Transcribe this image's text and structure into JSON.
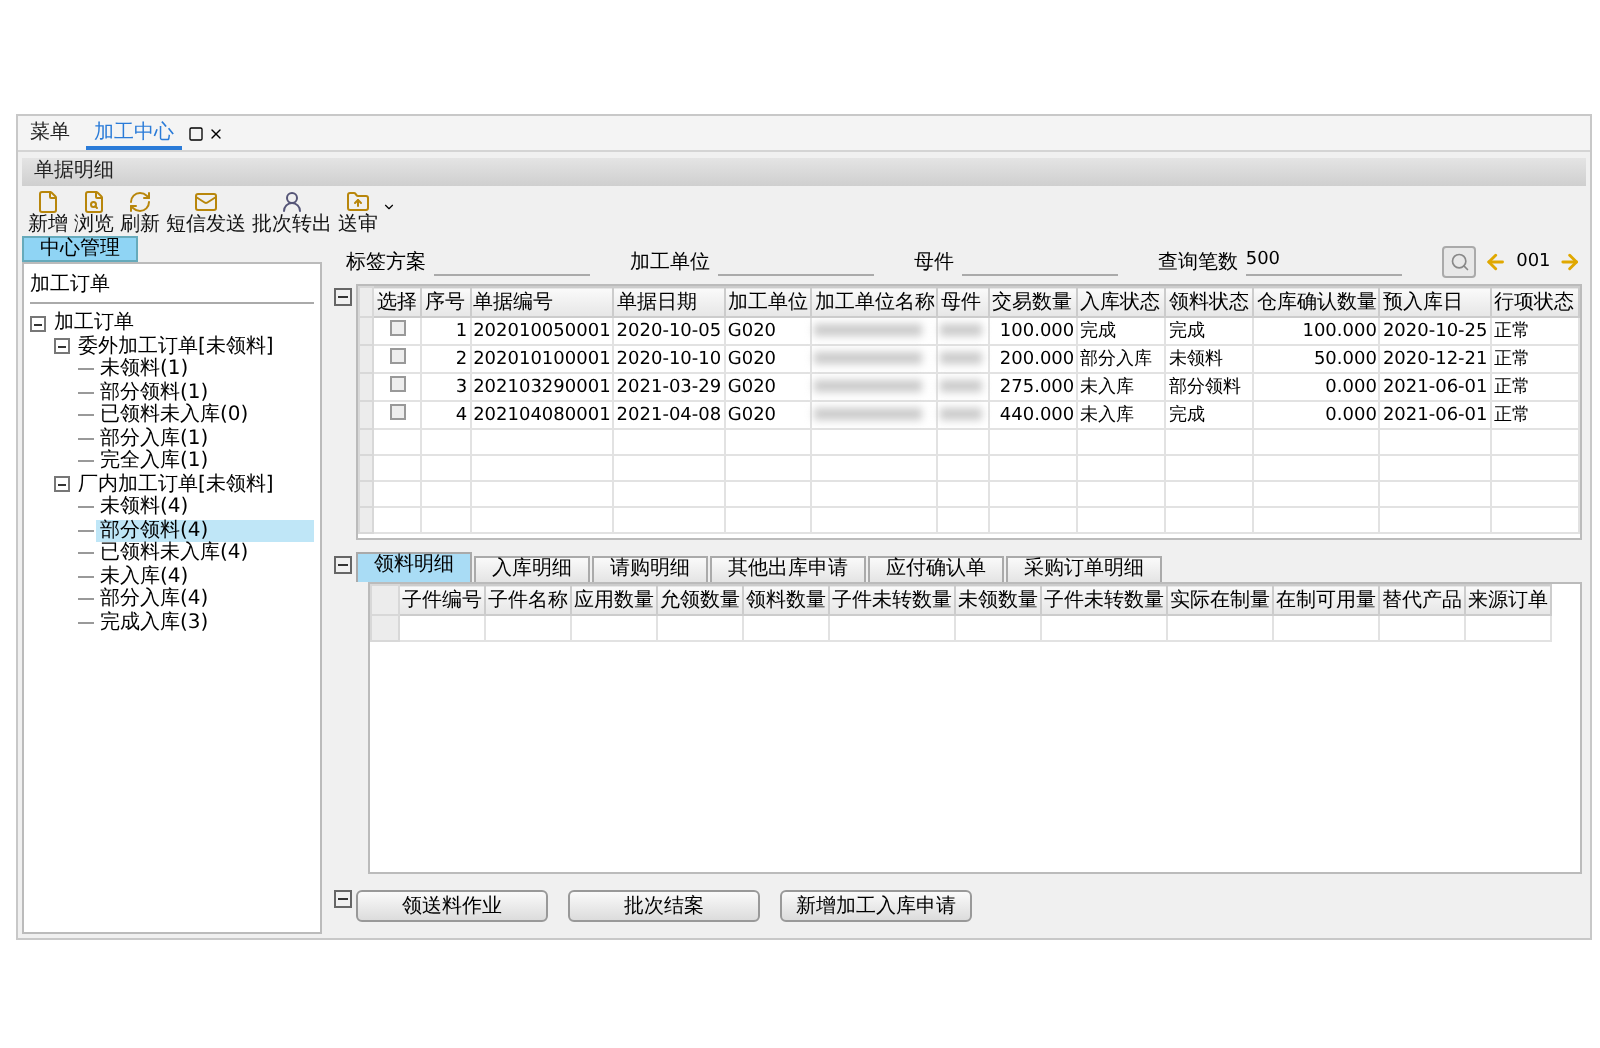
{
  "top_tabs": [
    {
      "label": "菜单",
      "selected": false
    },
    {
      "label": "加工中心",
      "selected": true,
      "closable": true
    }
  ],
  "title": "单据明细",
  "toolbar": [
    {
      "kind": "new",
      "label": "新增"
    },
    {
      "kind": "browse",
      "label": "浏览"
    },
    {
      "kind": "refresh",
      "label": "刷新"
    },
    {
      "kind": "mail",
      "label": "短信发送"
    },
    {
      "kind": "transfer",
      "label": "批次转出"
    },
    {
      "kind": "submit",
      "label": "送审"
    }
  ],
  "side_tab": "中心管理",
  "side_field": "加工订单",
  "tree": [
    {
      "label": "加工订单",
      "expanded": true,
      "selected": false,
      "children": [
        {
          "label": "委外加工订单[未领料]",
          "expanded": true,
          "selected": false,
          "children": [
            {
              "label": "未领料(1)",
              "selected": false
            },
            {
              "label": "部分领料(1)",
              "selected": false
            },
            {
              "label": "已领料未入库(0)",
              "selected": false
            },
            {
              "label": "部分入库(1)",
              "selected": false
            },
            {
              "label": "完全入库(1)",
              "selected": false
            }
          ]
        },
        {
          "label": "厂内加工订单[未领料]",
          "expanded": true,
          "selected": false,
          "children": [
            {
              "label": "未领料(4)",
              "selected": false
            },
            {
              "label": "部分领料(4)",
              "selected": true
            },
            {
              "label": "已领料未入库(4)",
              "selected": false
            },
            {
              "label": "未入库(4)",
              "selected": false
            },
            {
              "label": "部分入库(4)",
              "selected": false
            },
            {
              "label": "完成入库(3)",
              "selected": false
            }
          ]
        }
      ]
    }
  ],
  "filters": [
    {
      "label": "标签方案"
    },
    {
      "label": "加工单位"
    },
    {
      "label": "母件"
    },
    {
      "label": "查询笔数",
      "value": "500"
    }
  ],
  "page": "001",
  "columns": [
    "选择",
    "序号",
    "单据编号",
    "单据日期",
    "加工单位",
    "加工单位名称",
    "母件",
    "交易数量",
    "入库状态",
    "领料状态",
    "仓库确认数量",
    "预入库日",
    "行项状态"
  ],
  "rows": [
    {
      "checked": false,
      "seq": "1",
      "no": "202010050001",
      "date": "2020-10-05",
      "unit": "G020",
      "qty": "100.000",
      "in_status": "完成",
      "pick_status": "完成",
      "confirmed": "100.000",
      "due": "2020-10-25",
      "line_status": "正常"
    },
    {
      "checked": false,
      "seq": "2",
      "no": "202010100001",
      "date": "2020-10-10",
      "unit": "G020",
      "qty": "200.000",
      "in_status": "部分入库",
      "pick_status": "未领料",
      "confirmed": "50.000",
      "due": "2020-12-21",
      "line_status": "正常"
    },
    {
      "checked": false,
      "seq": "3",
      "no": "202103290001",
      "date": "2021-03-29",
      "unit": "G020",
      "qty": "275.000",
      "in_status": "未入库",
      "pick_status": "部分领料",
      "confirmed": "0.000",
      "due": "2021-06-01",
      "line_status": "正常"
    },
    {
      "checked": false,
      "seq": "4",
      "no": "202104080001",
      "date": "2021-04-08",
      "unit": "G020",
      "qty": "440.000",
      "in_status": "未入库",
      "pick_status": "完成",
      "confirmed": "0.000",
      "due": "2021-06-01",
      "line_status": "正常"
    }
  ],
  "sub_tabs": [
    {
      "label": "领料明细",
      "selected": true
    },
    {
      "label": "入库明细",
      "selected": false
    },
    {
      "label": "请购明细",
      "selected": false
    },
    {
      "label": "其他出库申请",
      "selected": false
    },
    {
      "label": "应付确认单",
      "selected": false
    },
    {
      "label": "采购订单明细",
      "selected": false
    }
  ],
  "sub_columns": [
    "子件编号",
    "子件名称",
    "应用数量",
    "允领数量",
    "领料数量",
    "子件未转数量",
    "未领数量",
    "子件未转数量",
    "实际在制量",
    "在制可用量",
    "替代产品",
    "来源订单"
  ],
  "buttons": [
    "领送料作业",
    "批次结案",
    "新增加工入库申请"
  ]
}
